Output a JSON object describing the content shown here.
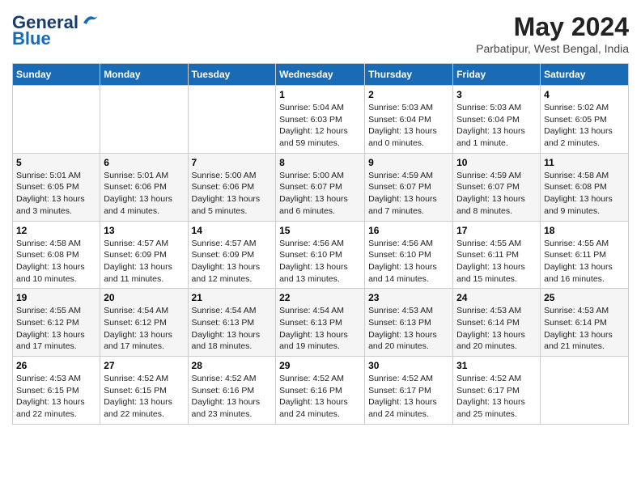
{
  "header": {
    "logo_line1": "General",
    "logo_line2": "Blue",
    "month": "May 2024",
    "location": "Parbatipur, West Bengal, India"
  },
  "days_of_week": [
    "Sunday",
    "Monday",
    "Tuesday",
    "Wednesday",
    "Thursday",
    "Friday",
    "Saturday"
  ],
  "weeks": [
    [
      {
        "day": "",
        "info": ""
      },
      {
        "day": "",
        "info": ""
      },
      {
        "day": "",
        "info": ""
      },
      {
        "day": "1",
        "info": "Sunrise: 5:04 AM\nSunset: 6:03 PM\nDaylight: 12 hours\nand 59 minutes."
      },
      {
        "day": "2",
        "info": "Sunrise: 5:03 AM\nSunset: 6:04 PM\nDaylight: 13 hours\nand 0 minutes."
      },
      {
        "day": "3",
        "info": "Sunrise: 5:03 AM\nSunset: 6:04 PM\nDaylight: 13 hours\nand 1 minute."
      },
      {
        "day": "4",
        "info": "Sunrise: 5:02 AM\nSunset: 6:05 PM\nDaylight: 13 hours\nand 2 minutes."
      }
    ],
    [
      {
        "day": "5",
        "info": "Sunrise: 5:01 AM\nSunset: 6:05 PM\nDaylight: 13 hours\nand 3 minutes."
      },
      {
        "day": "6",
        "info": "Sunrise: 5:01 AM\nSunset: 6:06 PM\nDaylight: 13 hours\nand 4 minutes."
      },
      {
        "day": "7",
        "info": "Sunrise: 5:00 AM\nSunset: 6:06 PM\nDaylight: 13 hours\nand 5 minutes."
      },
      {
        "day": "8",
        "info": "Sunrise: 5:00 AM\nSunset: 6:07 PM\nDaylight: 13 hours\nand 6 minutes."
      },
      {
        "day": "9",
        "info": "Sunrise: 4:59 AM\nSunset: 6:07 PM\nDaylight: 13 hours\nand 7 minutes."
      },
      {
        "day": "10",
        "info": "Sunrise: 4:59 AM\nSunset: 6:07 PM\nDaylight: 13 hours\nand 8 minutes."
      },
      {
        "day": "11",
        "info": "Sunrise: 4:58 AM\nSunset: 6:08 PM\nDaylight: 13 hours\nand 9 minutes."
      }
    ],
    [
      {
        "day": "12",
        "info": "Sunrise: 4:58 AM\nSunset: 6:08 PM\nDaylight: 13 hours\nand 10 minutes."
      },
      {
        "day": "13",
        "info": "Sunrise: 4:57 AM\nSunset: 6:09 PM\nDaylight: 13 hours\nand 11 minutes."
      },
      {
        "day": "14",
        "info": "Sunrise: 4:57 AM\nSunset: 6:09 PM\nDaylight: 13 hours\nand 12 minutes."
      },
      {
        "day": "15",
        "info": "Sunrise: 4:56 AM\nSunset: 6:10 PM\nDaylight: 13 hours\nand 13 minutes."
      },
      {
        "day": "16",
        "info": "Sunrise: 4:56 AM\nSunset: 6:10 PM\nDaylight: 13 hours\nand 14 minutes."
      },
      {
        "day": "17",
        "info": "Sunrise: 4:55 AM\nSunset: 6:11 PM\nDaylight: 13 hours\nand 15 minutes."
      },
      {
        "day": "18",
        "info": "Sunrise: 4:55 AM\nSunset: 6:11 PM\nDaylight: 13 hours\nand 16 minutes."
      }
    ],
    [
      {
        "day": "19",
        "info": "Sunrise: 4:55 AM\nSunset: 6:12 PM\nDaylight: 13 hours\nand 17 minutes."
      },
      {
        "day": "20",
        "info": "Sunrise: 4:54 AM\nSunset: 6:12 PM\nDaylight: 13 hours\nand 17 minutes."
      },
      {
        "day": "21",
        "info": "Sunrise: 4:54 AM\nSunset: 6:13 PM\nDaylight: 13 hours\nand 18 minutes."
      },
      {
        "day": "22",
        "info": "Sunrise: 4:54 AM\nSunset: 6:13 PM\nDaylight: 13 hours\nand 19 minutes."
      },
      {
        "day": "23",
        "info": "Sunrise: 4:53 AM\nSunset: 6:13 PM\nDaylight: 13 hours\nand 20 minutes."
      },
      {
        "day": "24",
        "info": "Sunrise: 4:53 AM\nSunset: 6:14 PM\nDaylight: 13 hours\nand 20 minutes."
      },
      {
        "day": "25",
        "info": "Sunrise: 4:53 AM\nSunset: 6:14 PM\nDaylight: 13 hours\nand 21 minutes."
      }
    ],
    [
      {
        "day": "26",
        "info": "Sunrise: 4:53 AM\nSunset: 6:15 PM\nDaylight: 13 hours\nand 22 minutes."
      },
      {
        "day": "27",
        "info": "Sunrise: 4:52 AM\nSunset: 6:15 PM\nDaylight: 13 hours\nand 22 minutes."
      },
      {
        "day": "28",
        "info": "Sunrise: 4:52 AM\nSunset: 6:16 PM\nDaylight: 13 hours\nand 23 minutes."
      },
      {
        "day": "29",
        "info": "Sunrise: 4:52 AM\nSunset: 6:16 PM\nDaylight: 13 hours\nand 24 minutes."
      },
      {
        "day": "30",
        "info": "Sunrise: 4:52 AM\nSunset: 6:17 PM\nDaylight: 13 hours\nand 24 minutes."
      },
      {
        "day": "31",
        "info": "Sunrise: 4:52 AM\nSunset: 6:17 PM\nDaylight: 13 hours\nand 25 minutes."
      },
      {
        "day": "",
        "info": ""
      }
    ]
  ]
}
